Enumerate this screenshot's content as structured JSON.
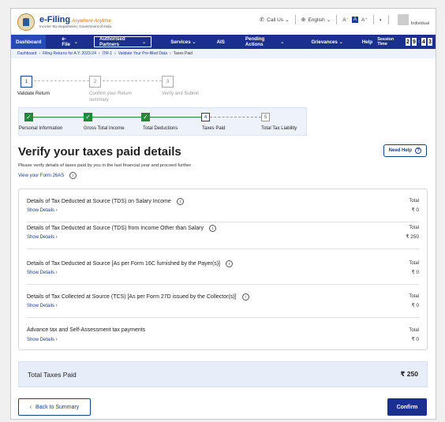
{
  "header": {
    "brand": "e-Filing",
    "tagline": "Anywhere Anytime",
    "dept": "Income Tax Department, Government of India",
    "call_us": "Call Us",
    "language": "English",
    "font_small": "A⁻",
    "font_normal": "A",
    "font_large": "A⁺",
    "contrast": "◐",
    "user_type": "Individual"
  },
  "nav": {
    "items": [
      "Dashboard",
      "e-File",
      "Authorised Partners",
      "Services",
      "AIS",
      "Pending Actions",
      "Grievances",
      "Help"
    ],
    "session_label": "Session Time",
    "session_digits": [
      "2",
      "9",
      "4",
      "3"
    ]
  },
  "breadcrumb": [
    "Dashboard",
    "Filing Returns for A.Y. 2023-24",
    "ITR-1",
    "Validate Your Pre-filled Data",
    "Taxes Paid"
  ],
  "steps": [
    {
      "num": "1",
      "label": "Validate Return"
    },
    {
      "num": "2",
      "label": "Confirm your Return summary"
    },
    {
      "num": "3",
      "label": "Verify and Submit"
    }
  ],
  "substeps": [
    {
      "label": "Personal Information"
    },
    {
      "label": "Gross Total Income"
    },
    {
      "label": "Total Deductions"
    },
    {
      "num": "4",
      "label": "Taxes Paid"
    },
    {
      "num": "5",
      "label": "Total Tax Liability"
    }
  ],
  "page": {
    "title": "Verify your taxes paid details",
    "need_help": "Need Help",
    "subtitle": "Please verify details of taxes paid by you in the last financial year and proceed further",
    "view_26as": "View your Form 26AS"
  },
  "rows": [
    {
      "title": "Details of Tax Deducted at Source (TDS) on Salary Income",
      "show": "Show Details",
      "total_label": "Total",
      "amount": "₹ 0"
    },
    {
      "title": "Details of Tax Deducted at Source (TDS) from Income Other than Salary",
      "show": "Show Details",
      "total_label": "Total",
      "amount": "₹ 250"
    },
    {
      "title": "Details of Tax Deducted at Source [As per Form 16C furnished by the Payer(s)]",
      "show": "Show Details",
      "total_label": "Total",
      "amount": "₹ 0"
    },
    {
      "title": "Details of Tax Collected at Source (TCS) [As per Form 27D issued by the Collector(s)]",
      "show": "Show Details",
      "total_label": "Total",
      "amount": "₹ 0"
    },
    {
      "title": "Advance tax and Self-Assessment tax payments",
      "show": "Show Details",
      "total_label": "Total",
      "amount": "₹ 0"
    }
  ],
  "total": {
    "label": "Total Taxes Paid",
    "value": "₹ 250"
  },
  "actions": {
    "back": "Back to Summary",
    "confirm": "Confirm"
  }
}
